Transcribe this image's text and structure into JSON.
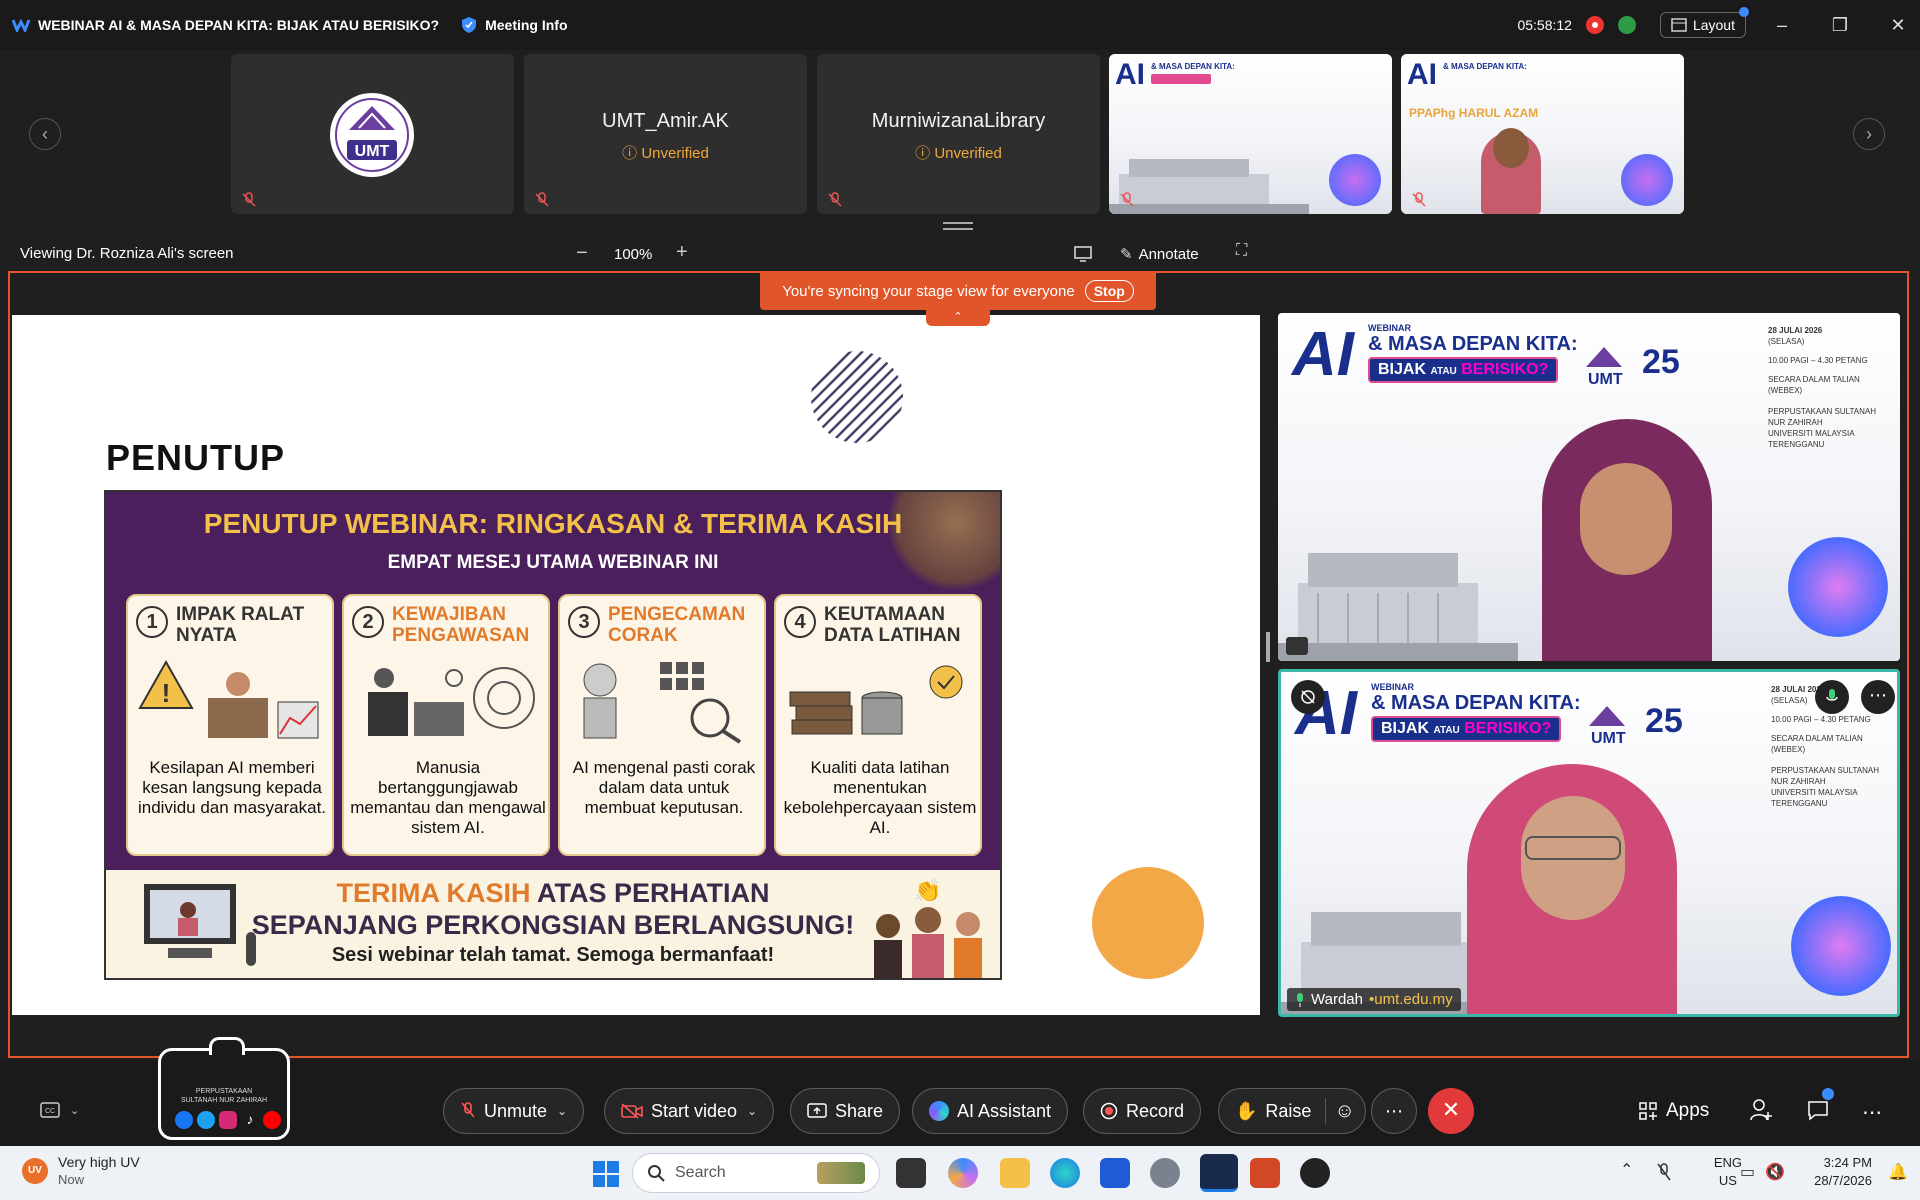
{
  "titlebar": {
    "title": "WEBINAR AI & MASA DEPAN KITA: BIJAK ATAU BERISIKO?",
    "meeting_info": "Meeting Info",
    "timer": "05:58:12",
    "layout_label": "Layout"
  },
  "participants": [
    {
      "name": "",
      "type": "logo"
    },
    {
      "name": "UMT_Amir.AK",
      "status": "Unverified"
    },
    {
      "name": "MurniwizanaLibrary",
      "status": "Unverified"
    },
    {
      "name": "",
      "type": "banner"
    },
    {
      "name": "PPAPhg HARUL AZAM",
      "type": "banner-person"
    }
  ],
  "viewbar": {
    "viewing_text": "Viewing Dr. Rozniza Ali's screen",
    "zoom": "100%",
    "annotate_label": "Annotate"
  },
  "sync_banner": {
    "text": "You're syncing your stage view for everyone",
    "stop_label": "Stop"
  },
  "slide": {
    "heading": "PENUTUP",
    "inner_title": "PENUTUP WEBINAR: RINGKASAN & TERIMA KASIH",
    "inner_subtitle": "EMPAT MESEJ UTAMA WEBINAR INI",
    "cards": [
      {
        "num": "1",
        "title_line1": "IMPAK RALAT",
        "title_line2": "NYATA",
        "body": "Kesilapan AI memberi kesan langsung kepada individu dan masyarakat."
      },
      {
        "num": "2",
        "title_line1": "KEWAJIBAN",
        "title_line2": "PENGAWASAN",
        "body": "Manusia bertanggungjawab memantau dan mengawal sistem AI."
      },
      {
        "num": "3",
        "title_line1": "PENGECAMAN",
        "title_line2": "CORAK",
        "body": "AI mengenal pasti corak dalam data untuk membuat keputusan."
      },
      {
        "num": "4",
        "title_line1": "KEUTAMAAN",
        "title_line2": "DATA LATIHAN",
        "body": "Kualiti data latihan menentukan kebolehpercayaan sistem AI."
      }
    ],
    "thanks_highlight": "TERIMA KASIH",
    "thanks_rest": " ATAS PERHATIAN",
    "thanks_line2": "SEPANJANG PERKONGSIAN BERLANGSUNG!",
    "thanks_line3": "Sesi webinar telah tamat. Semoga bermanfaat!"
  },
  "video_banner": {
    "webinar": "WEBINAR",
    "ai": "AI",
    "line1": "& MASA DEPAN KITA:",
    "bijak": "BIJAK",
    "atau": "ATAU",
    "berisiko": "BERISIKO?",
    "date": "28 JULAI 2026",
    "day": "(SELASA)",
    "time": "10.00 PAGI – 4.30 PETANG",
    "mode1": "SECARA DALAM TALIAN",
    "mode2": "(WEBEX)",
    "organizer1": "PERPUSTAKAAN SULTANAH NUR ZAHIRAH",
    "organizer2": "UNIVERSITI MALAYSIA TERENGGANU",
    "umt": "UMT"
  },
  "speaker": {
    "name": "Wardah",
    "org": "umt.edu.my"
  },
  "library_logo": {
    "line1": "PERPUSTAKAAN",
    "line2": "SULTANAH NUR ZAHIRAH"
  },
  "toolbar": {
    "unmute": "Unmute",
    "start_video": "Start video",
    "share": "Share",
    "ai_assistant": "AI Assistant",
    "record": "Record",
    "raise": "Raise",
    "apps": "Apps"
  },
  "taskbar": {
    "weather_title": "Very high UV",
    "weather_sub": "Now",
    "weather_badge": "UV",
    "search": "Search",
    "lang1": "ENG",
    "lang2": "US",
    "time": "3:24 PM",
    "date": "28/7/2026"
  },
  "colors": {
    "accent_orange": "#e0562a",
    "slide_purple": "#4a1f5c",
    "slide_gold": "#f3c14a",
    "card_orange": "#e07b2c",
    "circle_orange": "#f3a847",
    "speaker_border": "#3bb8a8"
  }
}
